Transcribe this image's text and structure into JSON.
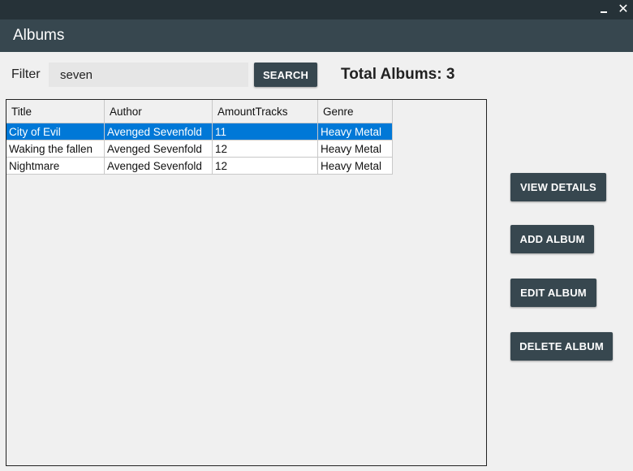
{
  "window": {
    "minimize_label": "",
    "close_label": "✕"
  },
  "header": {
    "title": "Albums"
  },
  "filter": {
    "label": "Filter",
    "value": "seven",
    "search_label": "SEARCH",
    "total_label": "Total Albums: 3"
  },
  "table": {
    "columns": [
      "Title",
      "Author",
      "AmountTracks",
      "Genre"
    ],
    "rows": [
      [
        "City of Evil",
        "Avenged Sevenfold",
        "11",
        "Heavy Metal"
      ],
      [
        "Waking the fallen",
        "Avenged Sevenfold",
        "12",
        "Heavy Metal"
      ],
      [
        "Nightmare",
        "Avenged Sevenfold",
        "12",
        "Heavy Metal"
      ]
    ],
    "selected_row": 0
  },
  "actions": {
    "view_label": "VIEW DETAILS",
    "add_label": "ADD ALBUM",
    "edit_label": "EDIT ALBUM",
    "delete_label": "DELETE ALBUM"
  },
  "colors": {
    "titlebar": "#263238",
    "header": "#37474f",
    "button": "#37474f",
    "selection": "#0078d7",
    "background": "#f0f0f0"
  }
}
